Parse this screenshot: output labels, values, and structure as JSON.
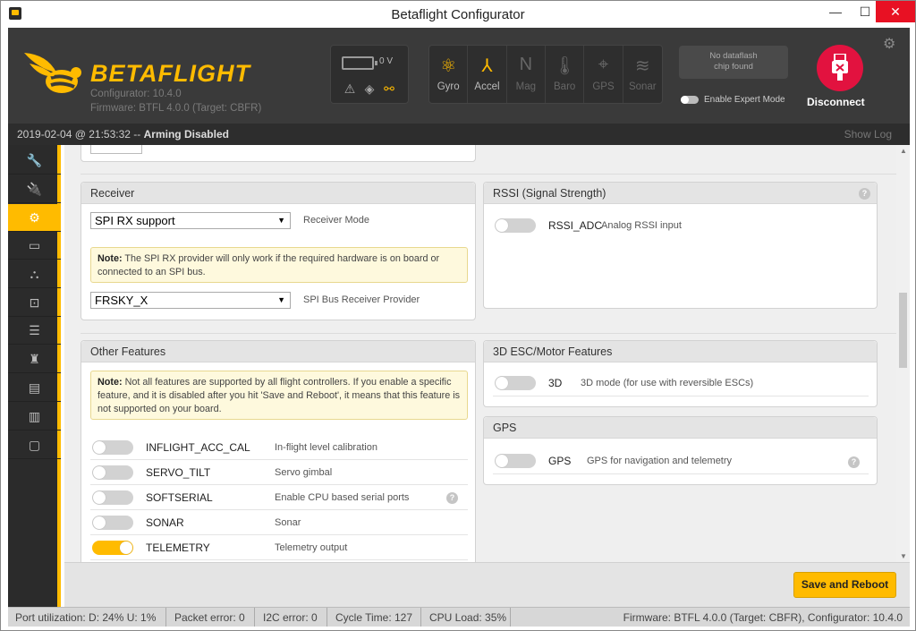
{
  "window": {
    "title": "Betaflight Configurator",
    "min": "—",
    "max": "☐",
    "close": "✕"
  },
  "header": {
    "logo_text": "BETAFLIGHT",
    "configurator_version": "Configurator: 10.4.0",
    "firmware_info": "Firmware: BTFL 4.0.0 (Target: CBFR)",
    "battery_voltage": "0 V",
    "sensors": [
      {
        "name": "Gyro",
        "icon": "gyro-icon",
        "glyph": "⚛",
        "active": true
      },
      {
        "name": "Accel",
        "icon": "accel-icon",
        "glyph": "⅄",
        "active": true
      },
      {
        "name": "Mag",
        "icon": "mag-icon",
        "glyph": "N",
        "active": false
      },
      {
        "name": "Baro",
        "icon": "baro-icon",
        "glyph": "🌡",
        "active": false
      },
      {
        "name": "GPS",
        "icon": "gps-icon",
        "glyph": "⌖",
        "active": false
      },
      {
        "name": "Sonar",
        "icon": "sonar-icon",
        "glyph": "≋",
        "active": false
      }
    ],
    "dataflash_line1": "No dataflash",
    "dataflash_line2": "chip found",
    "expert_mode_label": "Enable Expert Mode",
    "disconnect_label": "Disconnect"
  },
  "status": {
    "datetime": "2019-02-04 @ 21:53:32",
    "separator": " -- ",
    "arming": "Arming Disabled",
    "show_log": "Show Log"
  },
  "receiver": {
    "title": "Receiver",
    "mode_value": "SPI RX support",
    "mode_label": "Receiver Mode",
    "note_bold": "Note:",
    "note_text": " The SPI RX provider will only work if the required hardware is on board or connected to an SPI bus.",
    "provider_value": "FRSKY_X",
    "provider_label": "SPI Bus Receiver Provider"
  },
  "rssi": {
    "title": "RSSI (Signal Strength)",
    "feature_name": "RSSI_ADC",
    "feature_desc": "Analog RSSI input"
  },
  "other_features": {
    "title": "Other Features",
    "note_bold": "Note:",
    "note_text": " Not all features are supported by all flight controllers. If you enable a specific feature, and it is disabled after you hit 'Save and Reboot', it means that this feature is not supported on your board.",
    "items": [
      {
        "name": "INFLIGHT_ACC_CAL",
        "desc": "In-flight level calibration",
        "on": false
      },
      {
        "name": "SERVO_TILT",
        "desc": "Servo gimbal",
        "on": false
      },
      {
        "name": "SOFTSERIAL",
        "desc": "Enable CPU based serial ports",
        "on": false
      },
      {
        "name": "SONAR",
        "desc": "Sonar",
        "on": false
      },
      {
        "name": "TELEMETRY",
        "desc": "Telemetry output",
        "on": true
      }
    ]
  },
  "esc": {
    "title": "3D ESC/Motor Features",
    "feature_name": "3D",
    "feature_desc": "3D mode (for use with reversible ESCs)"
  },
  "gps": {
    "title": "GPS",
    "feature_name": "GPS",
    "feature_desc": "GPS for navigation and telemetry"
  },
  "help_glyph": "?",
  "save_button": "Save and Reboot",
  "footer": {
    "port_util": "Port utilization: D: 24% U: 1%",
    "packet_error": "Packet error: 0",
    "i2c_error": "I2C error: 0",
    "cycle_time": "Cycle Time: 127",
    "cpu_load": "CPU Load: 35%",
    "firmware": "Firmware: BTFL 4.0.0 (Target: CBFR), Configurator: 10.4.0"
  },
  "sidebar_icons": [
    "wrench-icon",
    "plug-icon",
    "gear-icon",
    "battery-icon",
    "hierarchy-icon",
    "robot-icon",
    "toggles-icon",
    "motor-icon",
    "osd-icon",
    "chip-icon",
    "cli-icon"
  ],
  "colors": {
    "accent": "#ffbb00",
    "disconnect": "#e2123f",
    "header_bg": "#3a3a3a"
  }
}
